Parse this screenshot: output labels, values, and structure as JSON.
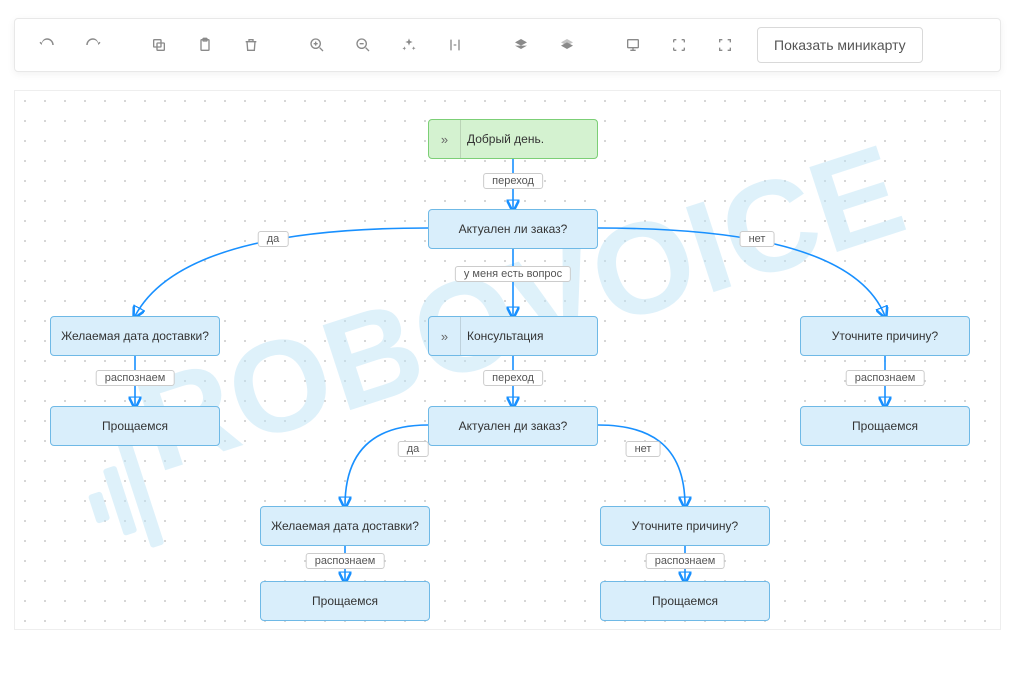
{
  "toolbar": {
    "minimap_label": "Показать миникарту"
  },
  "nodes": {
    "start": "Добрый день.",
    "q_actual": "Актуален ли заказ?",
    "q_date_left": "Желаемая дата доставки?",
    "consult": "Консультация",
    "q_reason_right": "Уточните причину?",
    "bye_left": "Прощаемся",
    "q_actual2": "Актуален ди заказ?",
    "bye_right": "Прощаемся",
    "q_date_center": "Желаемая дата доставки?",
    "q_reason_center": "Уточните причину?",
    "bye_center_left": "Прощаемся",
    "bye_center_right": "Прощаемся"
  },
  "edges": {
    "transition": "переход",
    "yes": "да",
    "no": "нет",
    "have_q": "у меня есть вопрос",
    "recognize": "распознаем"
  },
  "watermark": "ROBOVOICE"
}
